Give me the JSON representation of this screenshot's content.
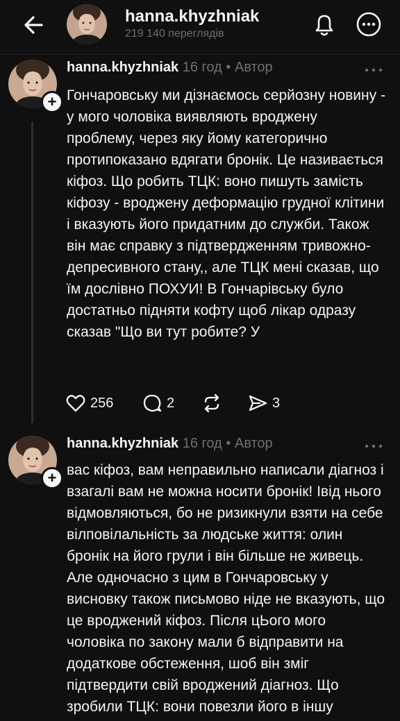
{
  "header": {
    "username": "hanna.khyzhniak",
    "views": "219 140 переглядів",
    "icons": {
      "back": "arrow-left-icon",
      "activity": "bell-icon",
      "more": "more-circle-icon"
    }
  },
  "posts": [
    {
      "username": "hanna.khyzhniak",
      "time": "16 год",
      "dot": "•",
      "badge": "Автор",
      "text": "Гончаровську ми дізнаємось серйозну новину - у мого чоловіка виявляють вроджену проблему, через яку йому категорично протипоказано вдягати бронік. Це називається кіфоз. Що робить ТЦК: воно пишуть замість кіфозу - вроджену деформацію грудної клітини і вказують його придатним до служби. Також він має справку з підтвердженням тривожно-депресивного стану,, але ТЦК мені сказав, що їм дослівно ПОХУИ! В Гончарівську було достатньо підняти кофту щоб лікар одразу сказав \"Що ви тут робите? У",
      "stats": {
        "likes": "256",
        "replies": "2",
        "shares": "3"
      }
    },
    {
      "username": "hanna.khyzhniak",
      "time": "16 год",
      "dot": "•",
      "badge": "Автор",
      "text": "вас кіфоз, вам неправильно написали діагноз і взагалі вам не можна носити бронік! Івід нього відмовляються, бо не ризикнули взяти на себе вілповілальність за людське життя: олин бронік на його грули і він більше не живець. Але одночасно з цим в Гончаровську у висновку також письмово ніде не вказують, що це вроджений кіфоз. Після цЬого мого чоловіка по закону мали б відправити на додаткове обстеження, шоб він зміг підтвердити свій вроджений діагноз. Що зробили ТЦК: вони повезли його в іншу"
    }
  ]
}
